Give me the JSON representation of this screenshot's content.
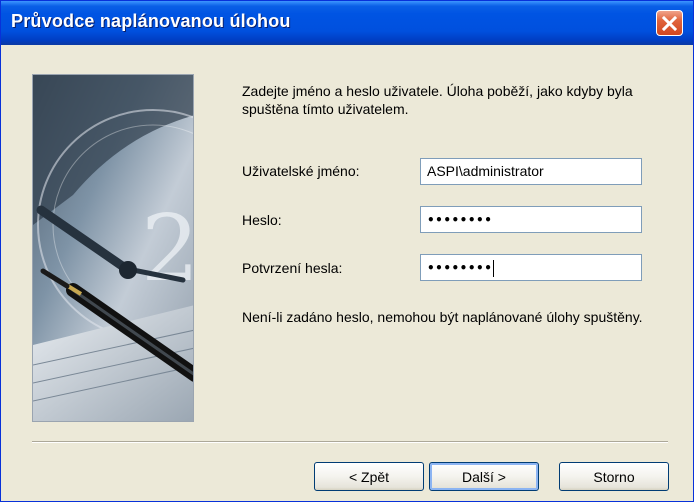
{
  "window": {
    "title": "Průvodce naplánovanou úlohou"
  },
  "intro": {
    "text": "Zadejte jméno a heslo uživatele. Úloha poběží, jako kdyby byla spuštěna tímto uživatelem."
  },
  "form": {
    "username_label": "Uživatelské jméno:",
    "username_value": "ASPI\\administrator",
    "password_label": "Heslo:",
    "password_mask": "••••••••",
    "confirm_label": "Potvrzení hesla:",
    "confirm_mask": "••••••••"
  },
  "note": {
    "text": "Není-li zadáno heslo, nemohou být naplánované úlohy spuštěny."
  },
  "buttons": {
    "back": "< Zpět",
    "next": "Další >",
    "cancel": "Storno"
  },
  "icons": {
    "close": "close-icon",
    "wizard_image": "clock-pen-illustration"
  },
  "colors": {
    "titlebar": "#0054e3",
    "close": "#d2471f",
    "face": "#ece9d8"
  }
}
